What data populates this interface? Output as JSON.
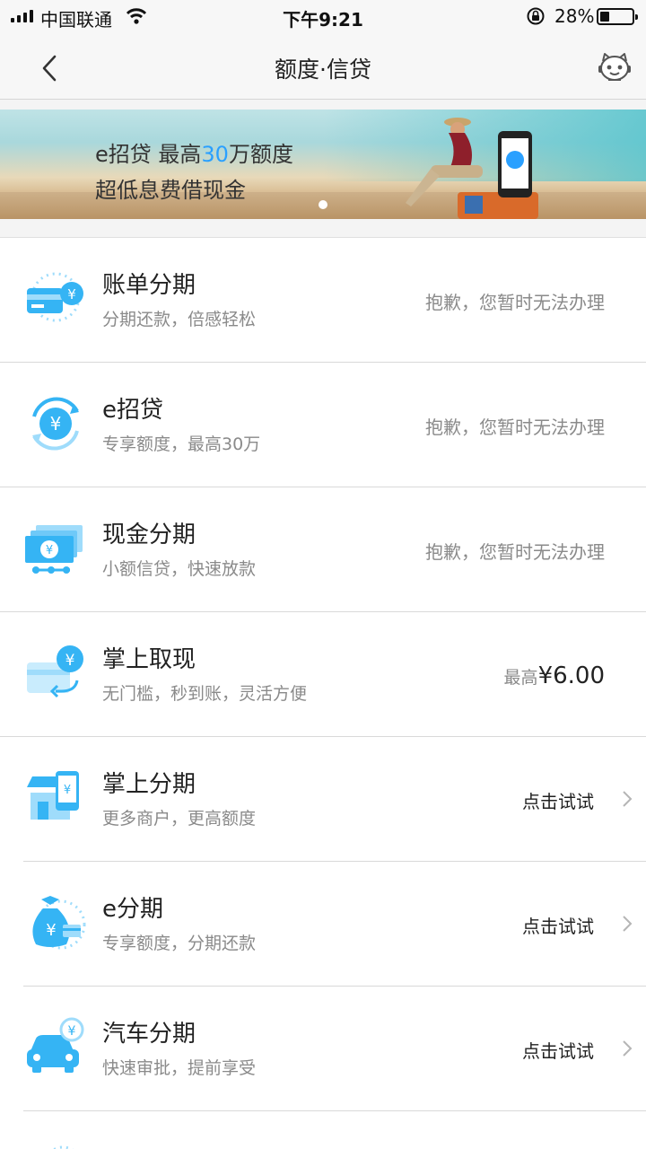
{
  "status_bar": {
    "carrier": "中国联通",
    "time": "下午9:21",
    "battery": "28%"
  },
  "nav": {
    "title": "额度·信贷",
    "back_icon": "chevron-left-icon",
    "assistant_icon": "robot-assistant-icon"
  },
  "banner": {
    "line1_a": "e招贷  最高",
    "line1_hl": "30",
    "line1_b": "万额度",
    "line2": "超低息费借现金",
    "accent": "#2aa0ff"
  },
  "items": [
    {
      "name": "账单分期",
      "desc": "分期还款，倍感轻松",
      "status": "抱歉，您暂时无法办理",
      "icon": "card-yuan-icon"
    },
    {
      "name": "e招贷",
      "desc": "专享额度，最高30万",
      "status": "抱歉，您暂时无法办理",
      "icon": "yuan-cycle-icon"
    },
    {
      "name": "现金分期",
      "desc": "小额信贷，快速放款",
      "status": "抱歉，您暂时无法办理",
      "icon": "cash-stack-icon"
    },
    {
      "name": "掌上取现",
      "desc": "无门槛，秒到账，灵活方便",
      "amount_prefix": "最高",
      "amount": "¥6.00",
      "icon": "card-withdraw-icon"
    },
    {
      "name": "掌上分期",
      "desc": "更多商户，更高额度",
      "action": "点击试试",
      "icon": "shop-phone-icon"
    },
    {
      "name": "e分期",
      "desc": "专享额度，分期还款",
      "action": "点击试试",
      "icon": "money-bag-icon"
    },
    {
      "name": "汽车分期",
      "desc": "快速审批，提前享受",
      "action": "点击试试",
      "icon": "car-yuan-icon"
    }
  ],
  "colors": {
    "icon_blue": "#35b4f4",
    "icon_light": "#9fdcfb"
  }
}
